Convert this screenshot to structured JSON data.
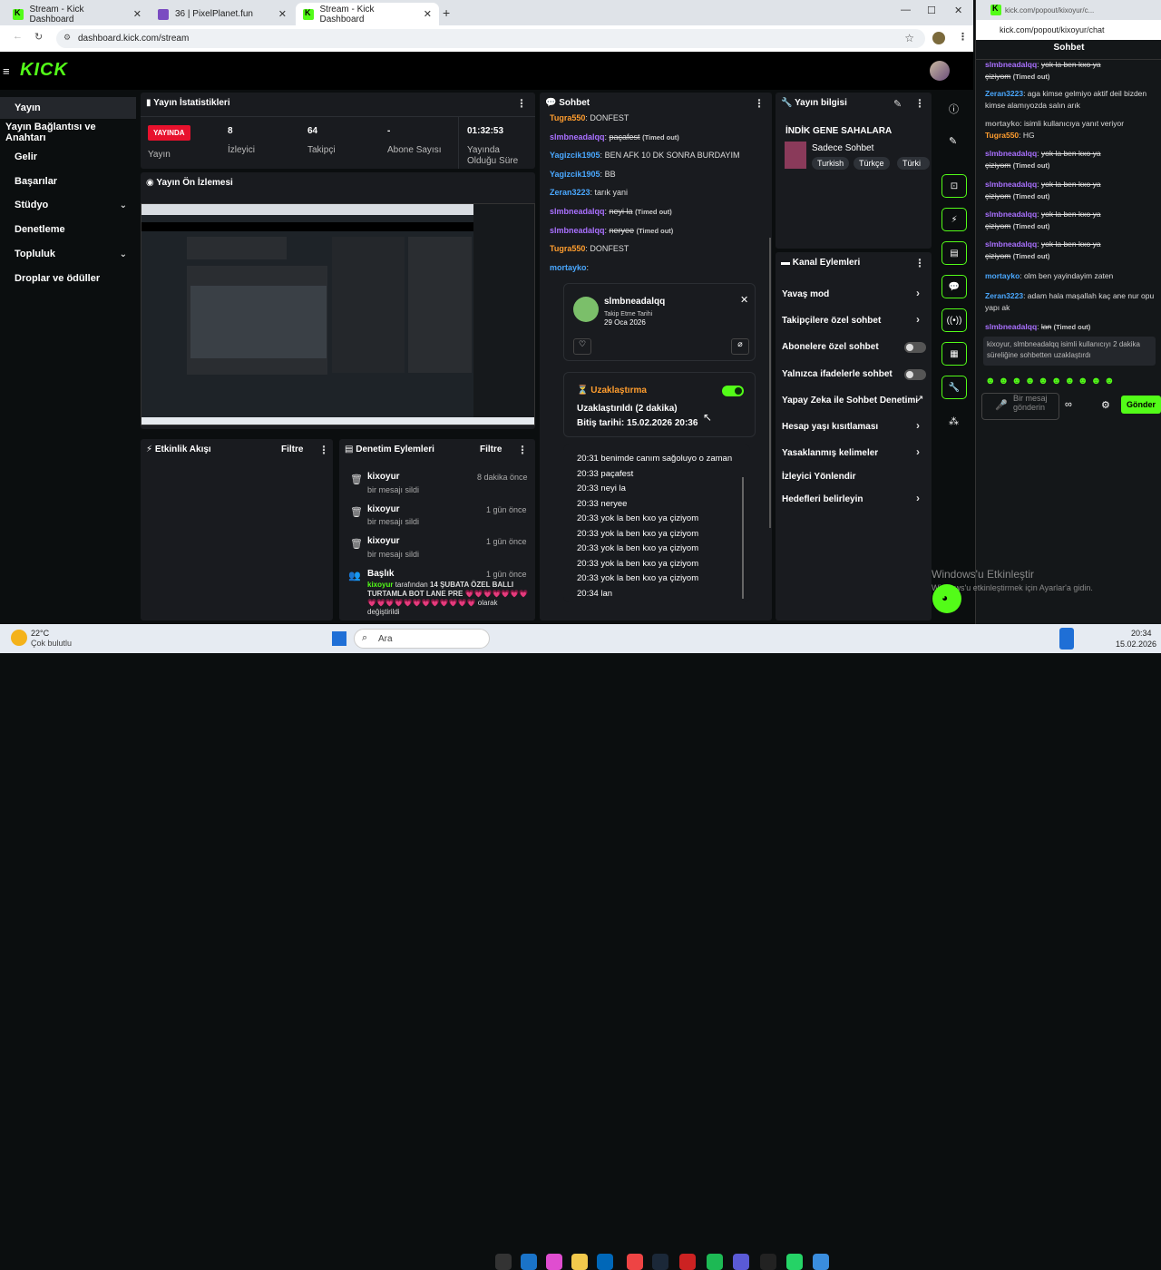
{
  "browser": {
    "tabs": [
      {
        "title": "Stream - Kick Dashboard",
        "icon": "kick-icon"
      },
      {
        "title": "36 | PixelPlanet.fun",
        "icon": "pixelplanet-icon"
      },
      {
        "title": "Stream - Kick Dashboard",
        "icon": "kick-icon"
      }
    ],
    "url": "dashboard.kick.com/stream"
  },
  "popout": {
    "title": "kick.com/popout/kixoyur/c...",
    "url": "kick.com/popout/kixoyur/chat",
    "header": "Sohbet",
    "messages": [
      {
        "user": "slmbneadalqq",
        "text": "yok la ben kxo ya",
        "cont": "çiziyom",
        "tag": "(Timed out)",
        "color": "#a970ff"
      },
      {
        "user": "Zeran3223",
        "text": "aga kimse gelmiyo aktif deil bizden kimse alamıyozda salın arık",
        "color": "#4aa8ff"
      },
      {
        "user": "mortayko",
        "text": "isimli kullanıcıya yanıt veriyor",
        "color": "#aaa"
      },
      {
        "user": "Tugra550",
        "text": "HG",
        "color": "#ff9d2e"
      },
      {
        "user": "slmbneadalqq",
        "text": "yok la ben kxo ya",
        "cont": "çiziyom",
        "tag": "(Timed out)",
        "color": "#a970ff"
      },
      {
        "user": "slmbneadalqq",
        "text": "yok la ben kxo ya",
        "cont": "çiziyom",
        "tag": "(Timed out)",
        "color": "#a970ff"
      },
      {
        "user": "slmbneadalqq",
        "text": "yok la ben kxo ya",
        "cont": "çiziyom",
        "tag": "(Timed out)",
        "color": "#a970ff"
      },
      {
        "user": "slmbneadalqq",
        "text": "yok la ben kxo ya",
        "cont": "çiziyom",
        "tag": "(Timed out)",
        "color": "#a970ff"
      },
      {
        "user": "mortayko",
        "text": "olm ben yayindayim zaten",
        "color": "#4aa8ff"
      },
      {
        "user": "Zeran3223",
        "text": "adam hala maşallah kaç ane nur opu yapı ak",
        "color": "#4aa8ff"
      },
      {
        "user": "slmbneadalqq",
        "text": "lan",
        "tag": "(Timed out)",
        "color": "#a970ff"
      }
    ],
    "sys": "kixoyur, slmbneadalqq isimli kullanıcıyı 2 dakika süreliğine sohbetten uzaklaştırdı",
    "input_placeholder": "Bir mesaj gönderin",
    "send": "Gönder"
  },
  "sidebar": {
    "items": [
      "Yayın",
      "Yayın Bağlantısı ve Anahtarı",
      "Gelir",
      "Başarılar",
      "Stüdyo",
      "Denetleme",
      "Topluluk",
      "Droplar ve ödüller"
    ]
  },
  "stats": {
    "title": "Yayın İstatistikleri",
    "live_badge": "YAYINDA",
    "cols": [
      {
        "value": "",
        "label": "Yayın"
      },
      {
        "value": "8",
        "label": "İzleyici"
      },
      {
        "value": "64",
        "label": "Takipçi"
      },
      {
        "value": "-",
        "label": "Abone Sayısı"
      },
      {
        "value": "01:32:53",
        "label": "Yayında Olduğu Süre"
      }
    ]
  },
  "preview": {
    "title": "Yayın Ön İzlemesi"
  },
  "activity": {
    "title": "Etkinlik Akışı",
    "filter": "Filtre"
  },
  "moderation": {
    "title": "Denetim Eylemleri",
    "filter": "Filtre",
    "items": [
      {
        "user": "kixoyur",
        "desc": "bir mesajı sildi",
        "time": "8 dakika önce"
      },
      {
        "user": "kixoyur",
        "desc": "bir mesajı sildi",
        "time": "1 gün önce"
      },
      {
        "user": "kixoyur",
        "desc": "bir mesajı sildi",
        "time": "1 gün önce"
      }
    ],
    "last": {
      "title": "Başlık",
      "time": "1 gün önce",
      "user": "kixoyur",
      "mid": "tarafından",
      "text": "14 ŞUBATA ÖZEL BALLI TURTAMLA BOT LANE PRE",
      "hearts": "💗💗💗💗💗💗💗💗💗💗💗💗💗💗💗💗💗💗💗",
      "tail": "olarak değiştirildi"
    }
  },
  "chat": {
    "title": "Sohbet",
    "messages": [
      {
        "user": "Tugra550",
        "text": "DONFEST",
        "color": "#ff9d2e"
      },
      {
        "user": "slmbneadalqq",
        "text": "paçafest",
        "tag": "(Timed out)",
        "color": "#a970ff",
        "strike": true
      },
      {
        "user": "Yagizcik1905",
        "text": "BEN AFK 10 DK SONRA BURDAYIM",
        "color": "#4aa8ff"
      },
      {
        "user": "Yagizcik1905",
        "text": "BB",
        "color": "#4aa8ff"
      },
      {
        "user": "Zeran3223",
        "text": "tarık yani",
        "color": "#4aa8ff"
      },
      {
        "user": "slmbneadalqq",
        "text": "neyi la",
        "tag": "(Timed out)",
        "color": "#a970ff",
        "strike": true
      },
      {
        "user": "slmbneadalqq",
        "text": "neryee",
        "tag": "(Timed out)",
        "color": "#a970ff",
        "strike": true
      },
      {
        "user": "Tugra550",
        "text": "DONFEST",
        "color": "#ff9d2e"
      },
      {
        "user": "mortayko",
        "text": "",
        "color": "#4aa8ff"
      }
    ],
    "usercard": {
      "name": "slmbneadalqq",
      "follow_label": "Takip Etme Tarihi",
      "follow_date": "29 Oca 2026"
    },
    "timeout": {
      "title": "Uzaklaştırma",
      "line1": "Uzaklaştırıldı (2 dakika)",
      "line2": "Bitiş tarihi: 15.02.2026 20:36"
    },
    "history": [
      "20:31 benimde canım sağoluyo o zaman",
      "20:33 paçafest",
      "20:33 neyi la",
      "20:33 neryee",
      "20:33 yok la ben kxo ya çiziyom",
      "20:33 yok la ben kxo ya çiziyom",
      "20:33 yok la ben kxo ya çiziyom",
      "20:33 yok la ben kxo ya çiziyom",
      "20:33 yok la ben kxo ya çiziyom",
      "20:34 lan"
    ]
  },
  "info": {
    "title": "Yayın bilgisi",
    "stream_title": "İNDİK GENE SAHALARA",
    "category": "Sadece Sohbet",
    "tags": [
      "Turkish",
      "Türkçe",
      "Türki"
    ]
  },
  "actions": {
    "title": "Kanal Eylemleri",
    "items": [
      {
        "label": "Yavaş mod",
        "ctl": "chevron"
      },
      {
        "label": "Takipçilere özel sohbet",
        "ctl": "chevron"
      },
      {
        "label": "Abonelere özel sohbet",
        "ctl": "switch"
      },
      {
        "label": "Yalnızca ifadelerle sohbet",
        "ctl": "switch"
      },
      {
        "label": "Yapay Zeka ile Sohbet Denetimi",
        "ctl": "external"
      },
      {
        "label": "Hesap yaşı kısıtlaması",
        "ctl": "chevron"
      },
      {
        "label": "Yasaklanmış kelimeler",
        "ctl": "chevron"
      },
      {
        "label": "İzleyici Yönlendir",
        "ctl": "none"
      },
      {
        "label": "Hedefleri belirleyin",
        "ctl": "chevron"
      }
    ]
  },
  "watermark": {
    "line1": "Windows'u Etkinleştir",
    "line2": "Windows'u etkinleştirmek için Ayarlar'a gidin."
  },
  "taskbar": {
    "temp": "22°C",
    "weather": "Çok bulutlu",
    "search": "Ara",
    "time": "20:34",
    "date": "15.02.2026"
  }
}
